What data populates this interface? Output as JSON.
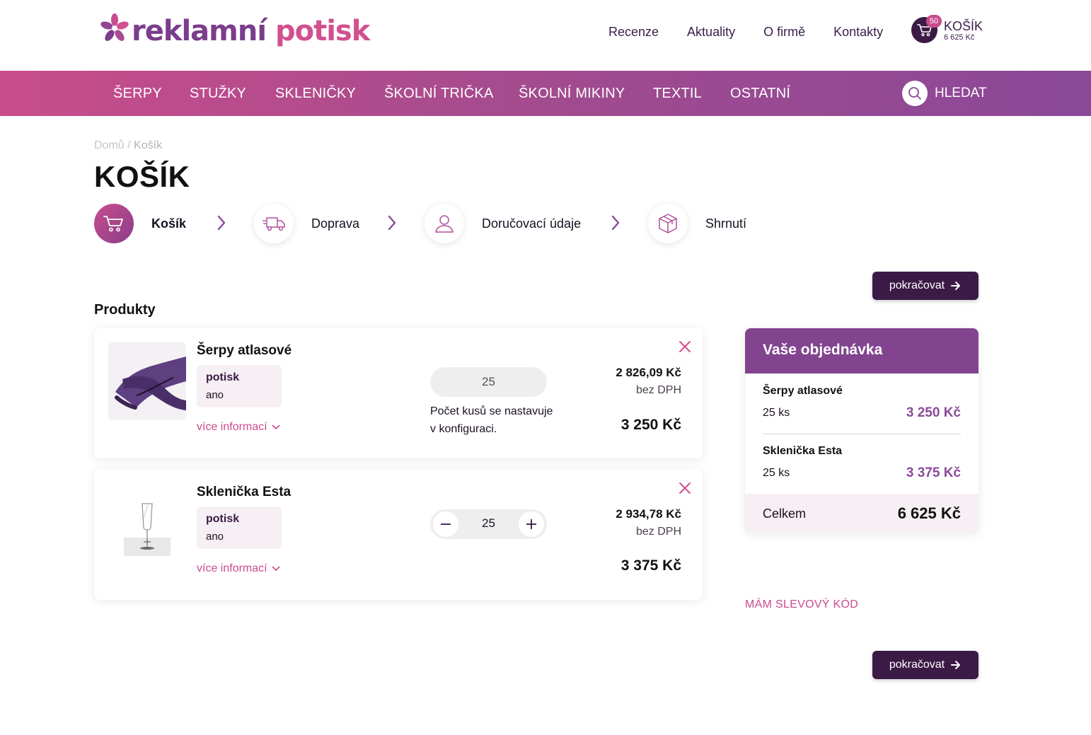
{
  "brand": {
    "part1": "reklamní",
    "part2": "potisk",
    "purple": "#7b3d8c",
    "pink": "#d2508f"
  },
  "topnav": [
    "Recenze",
    "Aktuality",
    "O firmě",
    "Kontakty"
  ],
  "cart_mini": {
    "count": "50",
    "title": "KOŠÍK",
    "sum": "6 625 Kč"
  },
  "nav": [
    "ŠERPY",
    "STUŽKY",
    "SKLENIČKY",
    "ŠKOLNÍ TRIČKA",
    "ŠKOLNÍ MIKINY",
    "TEXTIL",
    "OSTATNÍ"
  ],
  "search_label": "HLEDAT",
  "breadcrumb": {
    "home": "Domů",
    "sep": "/",
    "current": "Košík"
  },
  "page_title": "KOŠÍK",
  "steps": [
    {
      "label": "Košík",
      "icon": "cart-icon",
      "active": true
    },
    {
      "label": "Doprava",
      "icon": "truck-icon",
      "active": false
    },
    {
      "label": "Doručovací údaje",
      "icon": "user-icon",
      "active": false
    },
    {
      "label": "Shrnutí",
      "icon": "box-icon",
      "active": false
    }
  ],
  "continue_label": "pokračovat",
  "products_title": "Produkty",
  "products": [
    {
      "name": "Šerpy atlasové",
      "option_key": "potisk",
      "option_value": "ano",
      "more": "více informací",
      "quantity": "25",
      "quantity_note": "Počet kusů se nastavuje v konfiguraci.",
      "price_net": "2 826,09 Kč",
      "price_net_label": "bez DPH",
      "price_gross": "3 250 Kč"
    },
    {
      "name": "Sklenička Esta",
      "option_key": "potisk",
      "option_value": "ano",
      "more": "více informací",
      "quantity": "25",
      "price_net": "2 934,78 Kč",
      "price_net_label": "bez DPH",
      "price_gross": "3 375 Kč"
    }
  ],
  "summary": {
    "title": "Vaše objednávka",
    "items": [
      {
        "name": "Šerpy atlasové",
        "qty": "25 ks",
        "price": "3 250 Kč"
      },
      {
        "name": "Sklenička Esta",
        "qty": "25 ks",
        "price": "3 375 Kč"
      }
    ],
    "total_label": "Celkem",
    "total_value": "6 625 Kč"
  },
  "discount_label": "MÁM SLEVOVÝ KÓD",
  "colors": {
    "accent": "#c94b8d",
    "dark": "#3b1a45",
    "summary_header": "#82448f"
  }
}
